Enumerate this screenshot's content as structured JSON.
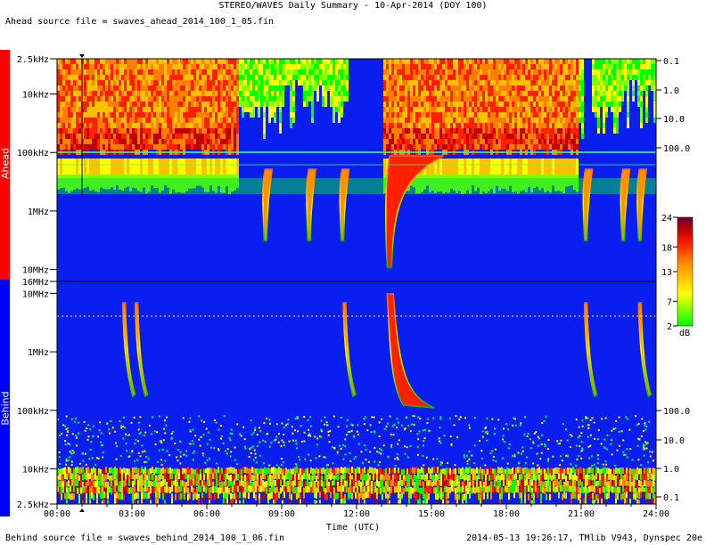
{
  "header": {
    "title": "STEREO/WAVES Daily Summary - 10-Apr-2014 (DOY 100)",
    "ahead_source": "Ahead source file = swaves_ahead_2014_100_1_05.fin"
  },
  "footer": {
    "behind_source": "Behind source file = swaves_behind_2014_100_1_06.fin",
    "generated": "2014-05-13 19:26:17, TMlib V943, Dynspec 20e"
  },
  "side_labels": {
    "ahead": "Ahead",
    "behind": "Behind"
  },
  "colors": {
    "ahead_band": "#ff0000",
    "behind_band": "#0000ff",
    "background_blue": "#0a1ef0",
    "colormap": [
      "#00ff00",
      "#80ff00",
      "#ffff00",
      "#ffc000",
      "#ff8000",
      "#ff2000",
      "#c00000",
      "#800000",
      "#6a0030"
    ]
  },
  "chart_data": {
    "type": "heatmap",
    "title": "STEREO/WAVES Daily Summary - 10-Apr-2014 (DOY 100)",
    "xlabel": "Time (UTC)",
    "x_ticks": [
      "00:00",
      "03:00",
      "06:00",
      "09:00",
      "12:00",
      "15:00",
      "18:00",
      "21:00",
      "24:00"
    ],
    "xlim": [
      "00:00",
      "24:00"
    ],
    "panels": [
      {
        "name": "Ahead",
        "y_scale": "log",
        "y_ticks": [
          "2.5kHz",
          "10kHz",
          "100kHz",
          "1MHz",
          "10MHz",
          "16MHz"
        ],
        "right_ticks": [
          "0.1",
          "1.0",
          "10.0",
          "100.0"
        ],
        "features": [
          {
            "kind": "type III burst",
            "start": "08:20"
          },
          {
            "kind": "type III burst",
            "start": "10:05"
          },
          {
            "kind": "type III burst",
            "start": "11:25"
          },
          {
            "kind": "type II/III event",
            "start": "13:20",
            "end": "14:30"
          },
          {
            "kind": "type III burst",
            "start": "21:10"
          },
          {
            "kind": "type III burst",
            "start": "22:40"
          },
          {
            "kind": "type III burst",
            "start": "23:20"
          }
        ]
      },
      {
        "name": "Behind",
        "y_scale": "log",
        "y_ticks": [
          "10MHz",
          "1MHz",
          "100kHz",
          "10kHz",
          "2.5kHz"
        ],
        "right_ticks": [
          "100.0",
          "10.0",
          "1.0",
          "0.1"
        ],
        "features": [
          {
            "kind": "type III burst",
            "start": "02:40"
          },
          {
            "kind": "type III burst",
            "start": "03:10"
          },
          {
            "kind": "type III burst",
            "start": "11:30"
          },
          {
            "kind": "type II/III event",
            "start": "13:20",
            "end": "15:00"
          },
          {
            "kind": "type III burst",
            "start": "21:10"
          },
          {
            "kind": "type III burst",
            "start": "23:20"
          }
        ]
      }
    ],
    "colorbar": {
      "unit": "dB",
      "ticks": [
        2,
        7,
        13,
        18,
        24
      ],
      "range": [
        2,
        24
      ]
    }
  }
}
